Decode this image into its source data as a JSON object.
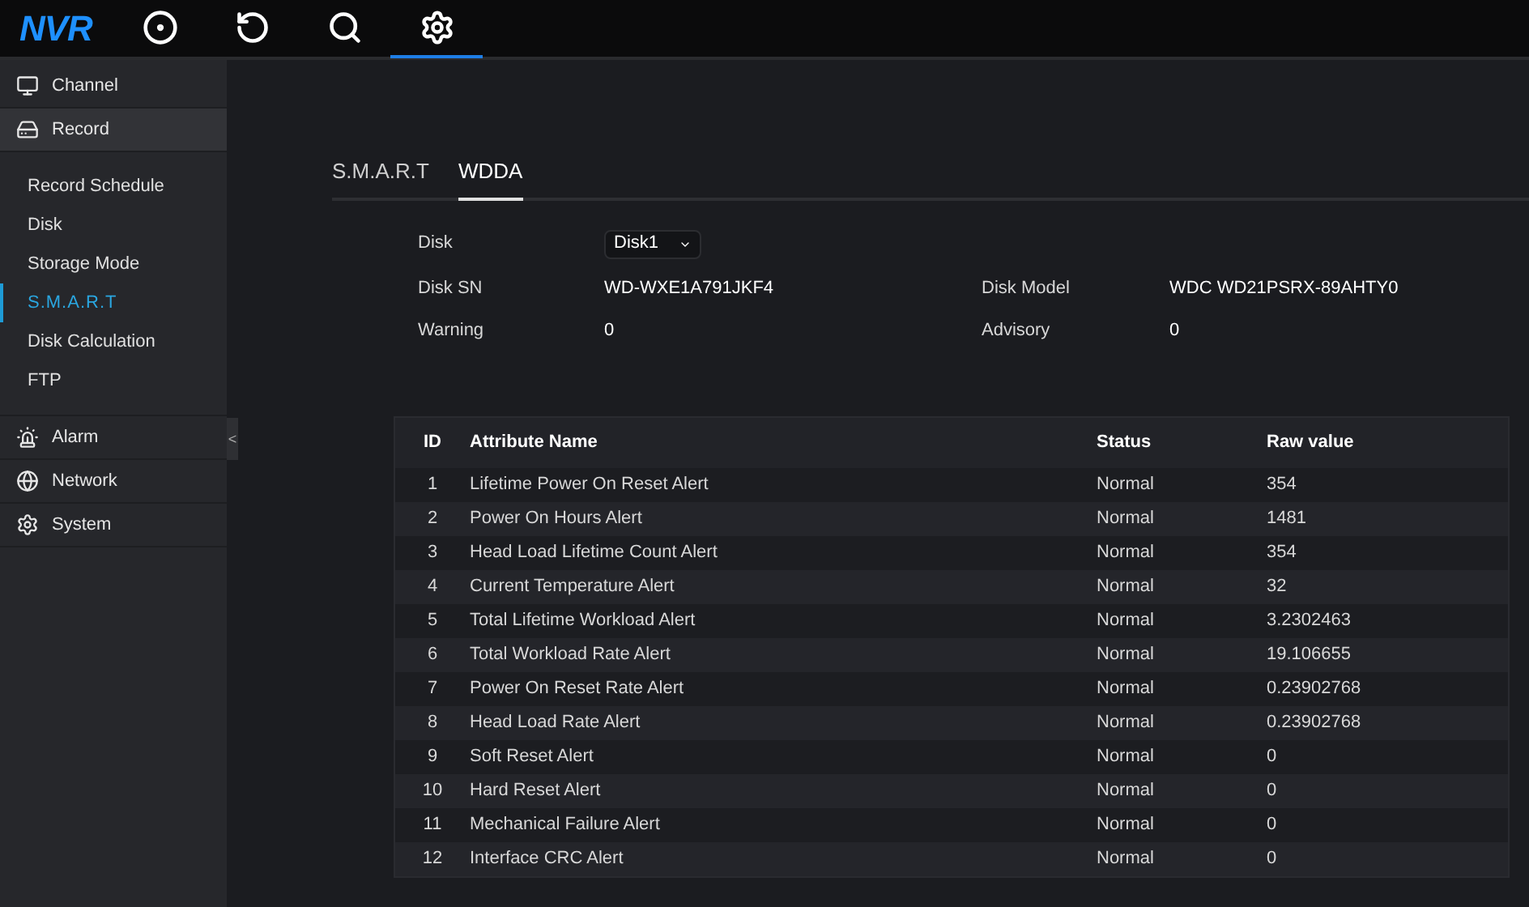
{
  "top_bar": {
    "logo": "NVR",
    "nav": [
      {
        "kind": "live",
        "selected": false
      },
      {
        "kind": "playback",
        "selected": false
      },
      {
        "kind": "search",
        "selected": false
      },
      {
        "kind": "settings",
        "selected": true
      }
    ]
  },
  "sidebar": {
    "items": [
      {
        "kind": "channel",
        "label": "Channel",
        "selected": false
      },
      {
        "kind": "record",
        "label": "Record",
        "selected": true,
        "children": [
          {
            "label": "Record Schedule",
            "selected": false
          },
          {
            "label": "Disk",
            "selected": false
          },
          {
            "label": "Storage Mode",
            "selected": false
          },
          {
            "label": "S.M.A.R.T",
            "selected": true
          },
          {
            "label": "Disk Calculation",
            "selected": false
          },
          {
            "label": "FTP",
            "selected": false
          }
        ]
      },
      {
        "kind": "alarm",
        "label": "Alarm",
        "selected": false
      },
      {
        "kind": "network",
        "label": "Network",
        "selected": false
      },
      {
        "kind": "system",
        "label": "System",
        "selected": false
      }
    ],
    "collapse_handle": "<"
  },
  "tabs": [
    {
      "label": "S.M.A.R.T",
      "selected": false
    },
    {
      "label": "WDDA",
      "selected": true
    }
  ],
  "form": {
    "disk": {
      "label": "Disk",
      "value": "Disk1"
    },
    "fields": [
      {
        "label": "Disk SN",
        "value": "WD-WXE1A791JKF4"
      },
      {
        "label": "Disk Model",
        "value": "WDC WD21PSRX-89AHTY0"
      },
      {
        "label": "Warning",
        "value": "0"
      },
      {
        "label": "Advisory",
        "value": "0"
      }
    ]
  },
  "table": {
    "columns": [
      "ID",
      "Attribute Name",
      "Status",
      "Raw value"
    ],
    "rows": [
      [
        "1",
        "Lifetime Power On Reset Alert",
        "Normal",
        "354"
      ],
      [
        "2",
        "Power On Hours Alert",
        "Normal",
        "1481"
      ],
      [
        "3",
        "Head Load Lifetime Count Alert",
        "Normal",
        "354"
      ],
      [
        "4",
        "Current Temperature Alert",
        "Normal",
        "32"
      ],
      [
        "5",
        "Total Lifetime Workload Alert",
        "Normal",
        "3.2302463"
      ],
      [
        "6",
        "Total Workload Rate Alert",
        "Normal",
        "19.106655"
      ],
      [
        "7",
        "Power On Reset Rate Alert",
        "Normal",
        "0.23902768"
      ],
      [
        "8",
        "Head Load Rate Alert",
        "Normal",
        "0.23902768"
      ],
      [
        "9",
        "Soft Reset Alert",
        "Normal",
        "0"
      ],
      [
        "10",
        "Hard Reset Alert",
        "Normal",
        "0"
      ],
      [
        "11",
        "Mechanical Failure Alert",
        "Normal",
        "0"
      ],
      [
        "12",
        "Interface CRC Alert",
        "Normal",
        "0"
      ]
    ]
  }
}
